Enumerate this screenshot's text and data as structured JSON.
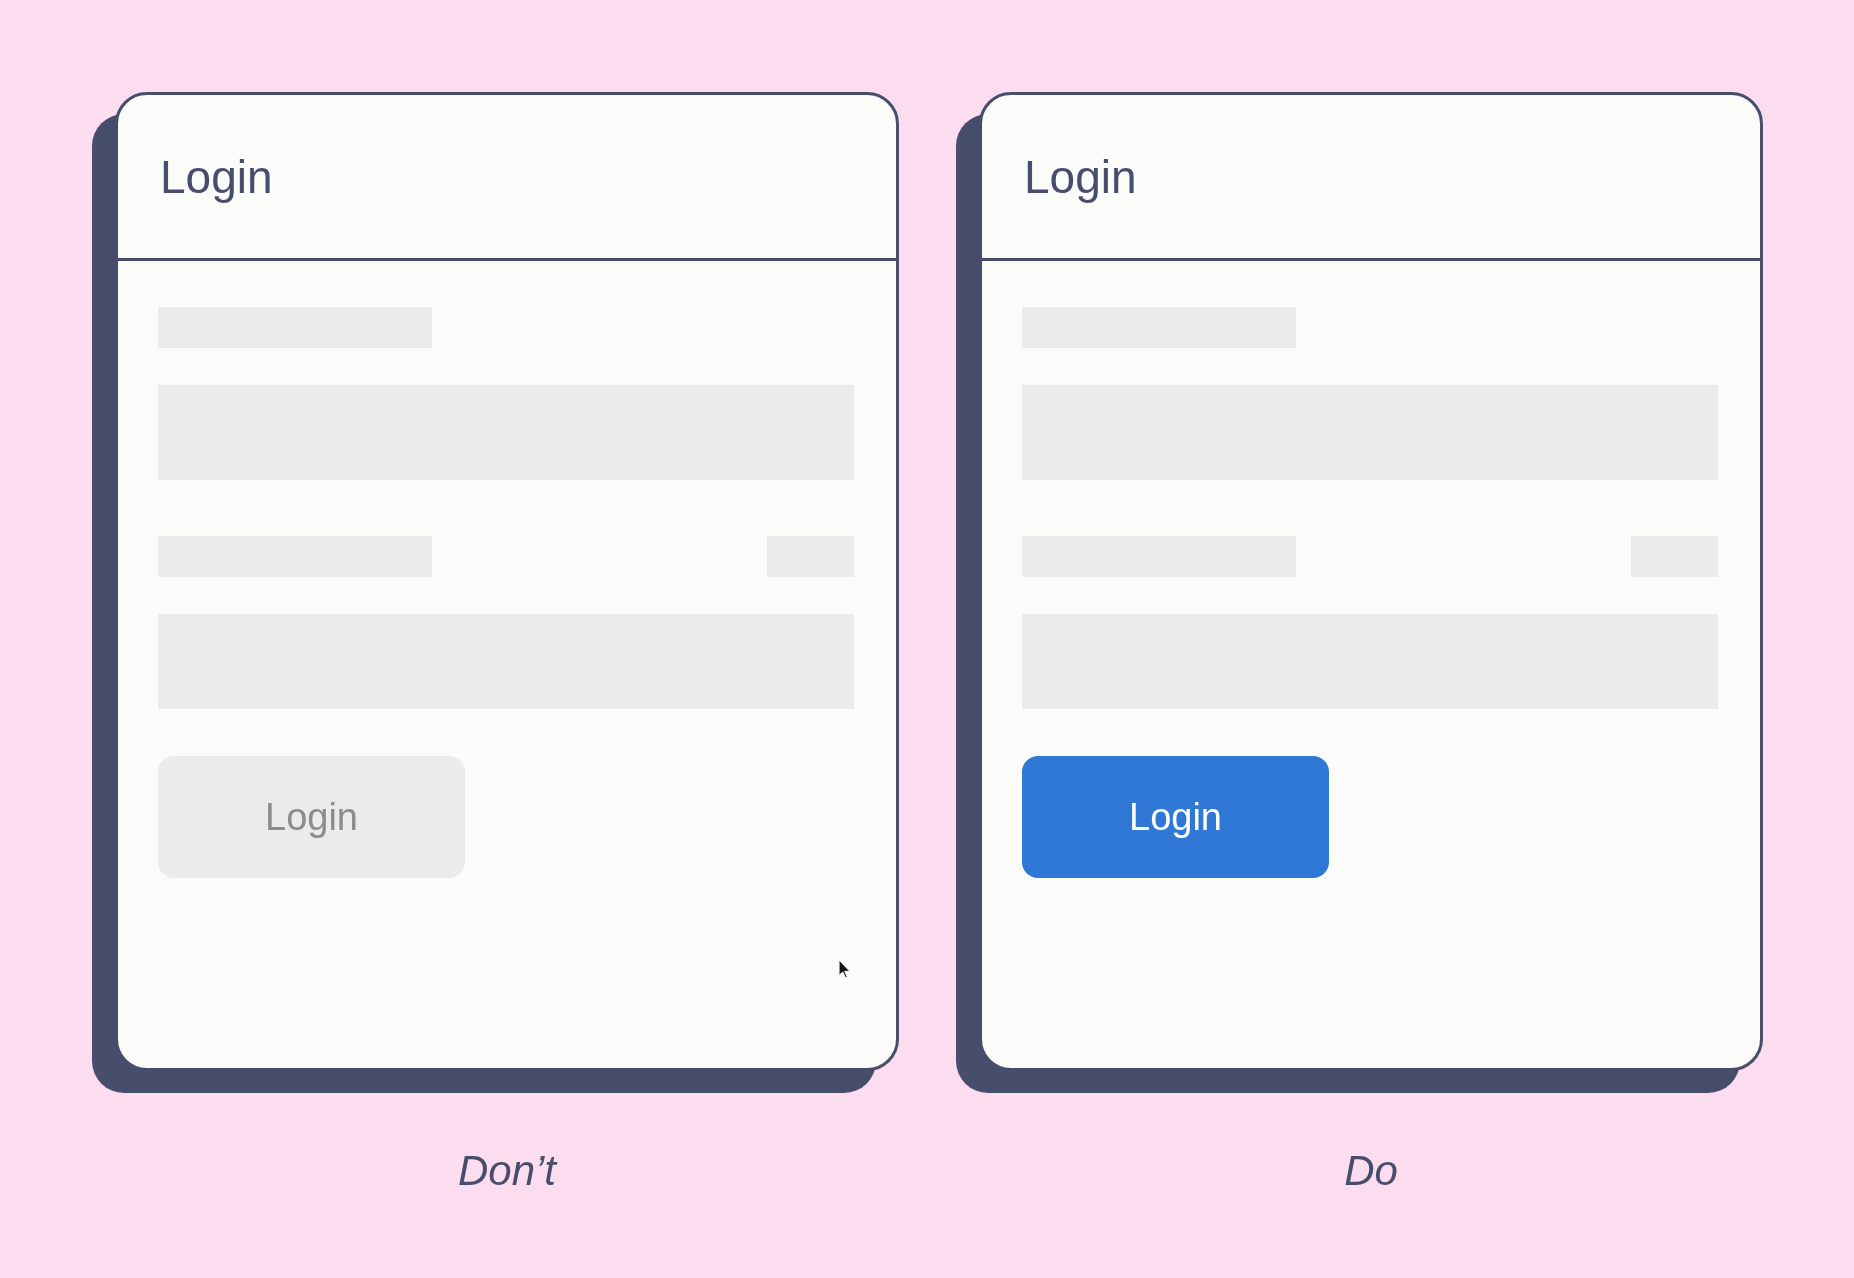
{
  "panels": [
    {
      "title": "Login",
      "button": {
        "label": "Login",
        "disabled": true
      },
      "caption": "Don’t",
      "pointer_visible": true
    },
    {
      "title": "Login",
      "button": {
        "label": "Login",
        "disabled": false
      },
      "caption": "Do",
      "pointer_visible": false
    }
  ]
}
